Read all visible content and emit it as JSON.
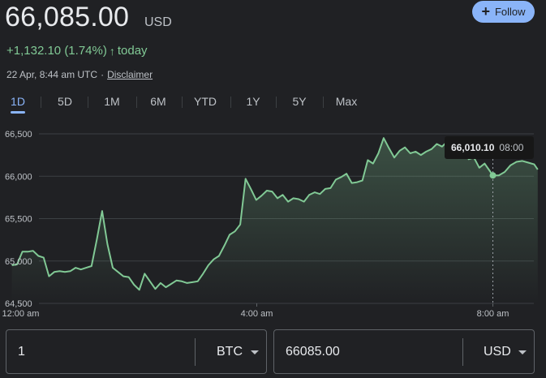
{
  "quote": {
    "price": "66,085.00",
    "currency": "USD",
    "change": "+1,132.10 (1.74%)",
    "change_period": "today",
    "timestamp": "22 Apr, 8:44 am UTC",
    "separator": "·",
    "disclaimer": "Disclaimer"
  },
  "follow_button": {
    "label": "Follow",
    "icon": "plus-icon"
  },
  "range_tabs": [
    "1D",
    "5D",
    "1M",
    "6M",
    "YTD",
    "1Y",
    "5Y",
    "Max"
  ],
  "selected_range": "1D",
  "tooltip": {
    "value": "66,010.10",
    "time": "08:00"
  },
  "converter": {
    "from_amount": "1",
    "from_unit": "BTC",
    "to_amount": "66085.00",
    "to_unit": "USD"
  },
  "colors": {
    "up": "#81c995",
    "line": "#81c995",
    "accent": "#8ab4f8",
    "background": "#202124"
  },
  "chart_data": {
    "type": "area",
    "ylim": [
      64500,
      66500
    ],
    "y_ticks": [
      "66,500",
      "66,000",
      "65,500",
      "65,000",
      "64,500"
    ],
    "y_tick_values": [
      66500,
      66000,
      65500,
      65000,
      64500
    ],
    "x_ticks": [
      "12:00 am",
      "4:00 am",
      "8:00 am"
    ],
    "x_tick_values": [
      0,
      4,
      8
    ],
    "xlim": [
      -0.35,
      8.9
    ],
    "grid": true,
    "highlight": {
      "x": 8.0,
      "y": 66010.1
    },
    "x": [
      -0.15,
      -0.06,
      0.03,
      0.12,
      0.21,
      0.3,
      0.39,
      0.48,
      0.57,
      0.66,
      0.75,
      0.84,
      0.93,
      1.02,
      1.11,
      1.2,
      1.29,
      1.38,
      1.47,
      1.56,
      1.65,
      1.74,
      1.83,
      1.92,
      2.01,
      2.1,
      2.19,
      2.28,
      2.37,
      2.46,
      2.55,
      2.64,
      2.73,
      2.82,
      2.91,
      3.0,
      3.09,
      3.18,
      3.27,
      3.36,
      3.45,
      3.54,
      3.63,
      3.72,
      3.81,
      3.9,
      3.99,
      4.08,
      4.17,
      4.26,
      4.35,
      4.44,
      4.53,
      4.62,
      4.71,
      4.8,
      4.89,
      4.98,
      5.07,
      5.16,
      5.25,
      5.34,
      5.43,
      5.52,
      5.61,
      5.7,
      5.79,
      5.88,
      5.97,
      6.06,
      6.15,
      6.24,
      6.33,
      6.42,
      6.51,
      6.6,
      6.69,
      6.78,
      6.87,
      6.96,
      7.05,
      7.14,
      7.23,
      7.32,
      7.41,
      7.5,
      7.59,
      7.68,
      7.77,
      7.86,
      7.95,
      8.0,
      8.1,
      8.2,
      8.3,
      8.4,
      8.5,
      8.6,
      8.7,
      8.76
    ],
    "y": [
      64950,
      64960,
      65110,
      65110,
      65120,
      65060,
      65040,
      64820,
      64870,
      64880,
      64870,
      64880,
      64920,
      64900,
      64920,
      64940,
      65250,
      65590,
      65200,
      64920,
      64870,
      64820,
      64810,
      64720,
      64660,
      64850,
      64760,
      64670,
      64740,
      64690,
      64730,
      64770,
      64760,
      64740,
      64750,
      64760,
      64850,
      64950,
      65020,
      65060,
      65180,
      65310,
      65350,
      65430,
      65970,
      65850,
      65720,
      65770,
      65830,
      65820,
      65740,
      65780,
      65700,
      65740,
      65730,
      65700,
      65780,
      65810,
      65790,
      65850,
      65860,
      65960,
      65990,
      66030,
      65920,
      65930,
      65950,
      66190,
      66150,
      66270,
      66450,
      66330,
      66220,
      66300,
      66340,
      66270,
      66290,
      66250,
      66290,
      66320,
      66380,
      66350,
      66410,
      66410,
      66340,
      66330,
      66200,
      66220,
      66100,
      66150,
      66060,
      66010,
      66010,
      66050,
      66130,
      66170,
      66180,
      66160,
      66140,
      66080
    ]
  }
}
